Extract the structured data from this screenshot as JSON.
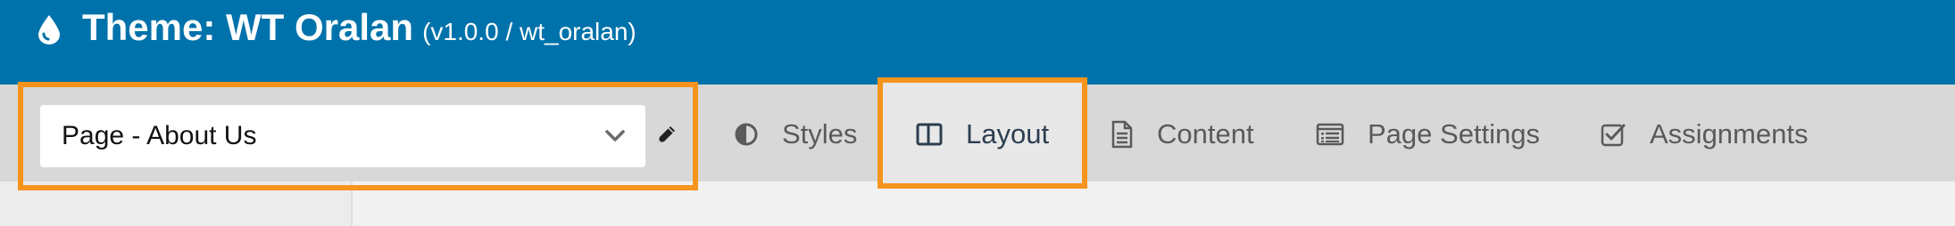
{
  "header": {
    "title": "Theme: WT Oralan",
    "version": "(v1.0.0 / wt_oralan)",
    "icon": "drop-icon"
  },
  "template_selector": {
    "value": "Page - About Us",
    "icon": "chevron-down-icon",
    "edit_icon": "pencil-icon"
  },
  "tabs": [
    {
      "label": "Styles",
      "icon": "contrast-icon",
      "active": false
    },
    {
      "label": "Layout",
      "icon": "columns-icon",
      "active": true
    },
    {
      "label": "Content",
      "icon": "document-icon",
      "active": false
    },
    {
      "label": "Page Settings",
      "icon": "list-window-icon",
      "active": false
    },
    {
      "label": "Assignments",
      "icon": "checkbox-icon",
      "active": false
    }
  ],
  "colors": {
    "header_bg": "#0072ab",
    "highlight": "#f7941d",
    "tabbar_bg": "#d8d8d8"
  }
}
